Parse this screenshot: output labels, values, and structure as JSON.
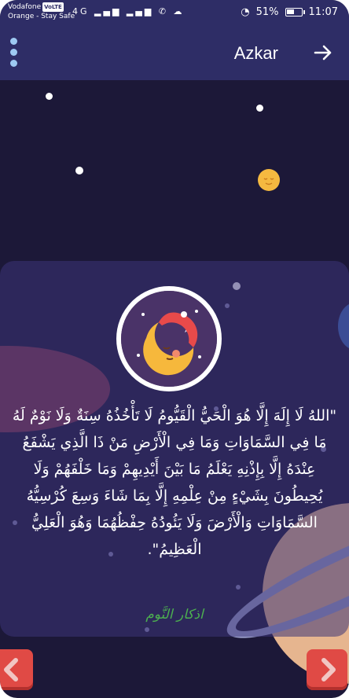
{
  "status_bar": {
    "carrier_line1": "Vodafone",
    "volte": "VoLTE",
    "carrier_line2": "Orange - Stay Safe",
    "network": "4G",
    "battery": "51%",
    "battery_level": 0.51,
    "time": "11:07"
  },
  "app_bar": {
    "title": "Azkar",
    "menu_icon": "more-vert-icon",
    "forward_icon": "arrow-right-icon"
  },
  "card": {
    "image_icon": "sleeping-moon-icon",
    "zekr_text": "\"اللهُ لَا إِلَهَ إِلَّا هُوَ الْحَيُّ الْقَيُّومُ لَا تَأْخُذُهُ سِنَةٌ وَلَا نَوْمٌ لَهُ مَا فِي السَّمَاوَاتِ وَمَا فِي الْأَرْضِ مَنْ ذَا الَّذِي يَشْفَعُ عِنْدَهُ إِلَّا بِإِذْنِهِ يَعْلَمُ مَا بَيْنَ أَيْدِيهِمْ وَمَا خَلْفَهُمْ وَلَا يُحِيطُونَ بِشَيْءٍ مِنْ عِلْمِهِ إِلَّا بِمَا شَاءَ وَسِعَ كُرْسِيُّهُ السَّمَاوَاتِ وَالْأَرْضَ وَلَا يَئُودُهُ حِفْظُهُمَا وَهُوَ الْعَلِيُّ الْعَظِيمُ\".",
    "source": "اذكار النَّوم"
  },
  "navigation": {
    "prev_icon": "chevron-left-icon",
    "next_icon": "chevron-right-icon"
  },
  "colors": {
    "app_bar": "#2e2d66",
    "background": "#1c1838",
    "source_text": "#4caf50",
    "nav_button": "#e04a45"
  }
}
